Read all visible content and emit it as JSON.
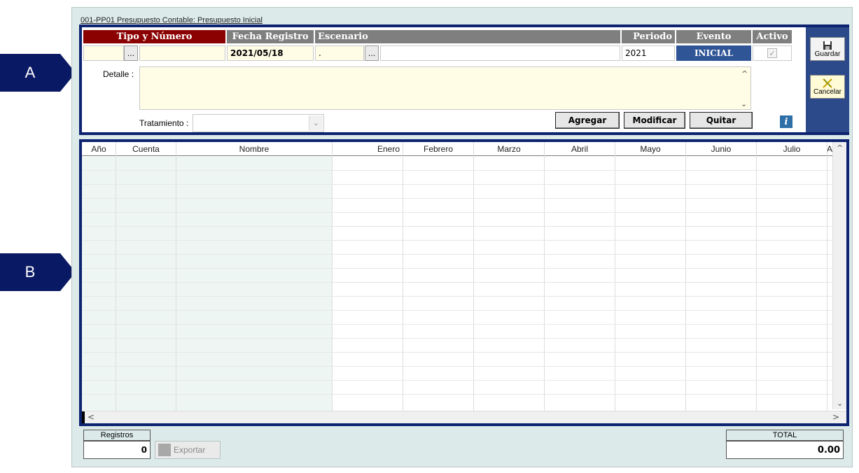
{
  "markers": {
    "a": "A",
    "b": "B"
  },
  "window": {
    "title": "001-PP01  Presupuesto Contable: Presupuesto Inicial"
  },
  "header": {
    "tipo_numero": "Tipo y Número",
    "fecha_registro": "Fecha Registro",
    "escenario": "Escenario",
    "periodo": "Periodo",
    "evento": "Evento",
    "activo": "Activo",
    "colors": {
      "tipo_bg": "#8b0000",
      "gray_bg": "#7f7f7f",
      "accent": "#0d2370",
      "evento_bg": "#2f5596"
    }
  },
  "fields": {
    "tipo_value": "",
    "numero_value": "",
    "fecha_value": "2021/05/18",
    "escenario_code": ".",
    "escenario_desc": "",
    "periodo_value": "2021",
    "evento_value": "INICIAL",
    "activo_checked": true,
    "dots_label": "...",
    "detalle_label": "Detalle :",
    "detalle_value": "",
    "tratamiento_label": "Tratamiento :",
    "tratamiento_value": ""
  },
  "buttons": {
    "guardar": "Guardar",
    "cancelar": "Cancelar",
    "agregar": "Agregar",
    "modificar": "Modificar",
    "quitar": "Quitar",
    "info": "i",
    "exportar": "Exportar"
  },
  "grid": {
    "columns": [
      "Año",
      "Cuenta",
      "Nombre",
      "Enero",
      "Febrero",
      "Marzo",
      "Abril",
      "Mayo",
      "Junio",
      "Julio",
      "A"
    ],
    "rows": []
  },
  "footer": {
    "registros_label": "Registros",
    "registros_value": "0",
    "total_label": "TOTAL",
    "total_value": "0.00"
  },
  "icons": {
    "save": "floppy-icon",
    "cancel": "x-icon",
    "info": "info-icon",
    "scroll_up": "^",
    "scroll_down": "⌄",
    "scroll_left": "<",
    "scroll_right": ">"
  }
}
